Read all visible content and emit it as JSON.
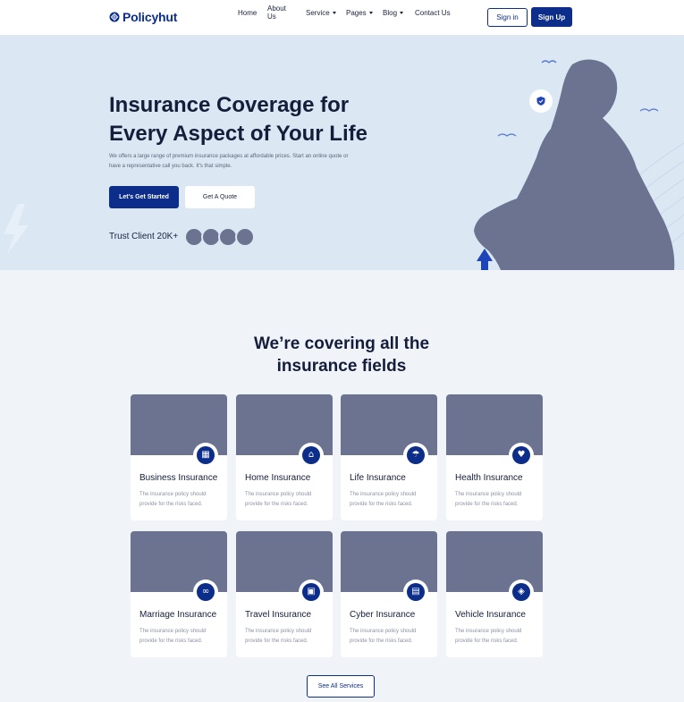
{
  "brand": {
    "name": "Policyhut",
    "color": "#0c2e8a"
  },
  "nav": {
    "items": [
      {
        "label": "Home",
        "dropdown": false
      },
      {
        "label": "About Us",
        "dropdown": false
      },
      {
        "label": "Service",
        "dropdown": true
      },
      {
        "label": "Pages",
        "dropdown": true
      },
      {
        "label": "Blog",
        "dropdown": true
      },
      {
        "label": "Contact Us",
        "dropdown": false
      }
    ],
    "signin_label": "Sign in",
    "signup_label": "Sign Up"
  },
  "hero": {
    "title_line1": "Insurance Coverage for",
    "title_line2": "Every Aspect of Your Life",
    "description": "We offers a large range of premium insurance packages at affordable prices. Start an online quote or have a representative call you back. It's that simple.",
    "primary_cta": "Let's Get Started",
    "secondary_cta": "Get A Quote",
    "trust_label": "Trust Client 20K+",
    "background_color": "#dbe8f4"
  },
  "services": {
    "title_line1": "We’re covering all the",
    "title_line2": "insurance fields",
    "cards": [
      {
        "title": "Business Insurance",
        "description": "The insurance policy should provide for the risks faced.",
        "icon": "building-icon"
      },
      {
        "title": "Home Insurance",
        "description": "The insurance policy should provide for the risks faced.",
        "icon": "home-hand-icon"
      },
      {
        "title": "Life Insurance",
        "description": "The insurance policy should provide for the risks faced.",
        "icon": "umbrella-family-icon"
      },
      {
        "title": "Health Insurance",
        "description": "The insurance policy should provide for the risks faced.",
        "icon": "heart-hand-icon"
      },
      {
        "title": "Marriage Insurance",
        "description": "The insurance policy should provide for the risks faced.",
        "icon": "rings-icon"
      },
      {
        "title": "Travel Insurance",
        "description": "The insurance policy should provide for the risks faced.",
        "icon": "luggage-shield-icon"
      },
      {
        "title": "Cyber Insurance",
        "description": "The insurance policy should provide for the risks faced.",
        "icon": "browser-shield-icon"
      },
      {
        "title": "Vehicle Insurance",
        "description": "The insurance policy should provide for the risks faced.",
        "icon": "car-shield-icon"
      }
    ],
    "see_all_label": "See All Services"
  }
}
